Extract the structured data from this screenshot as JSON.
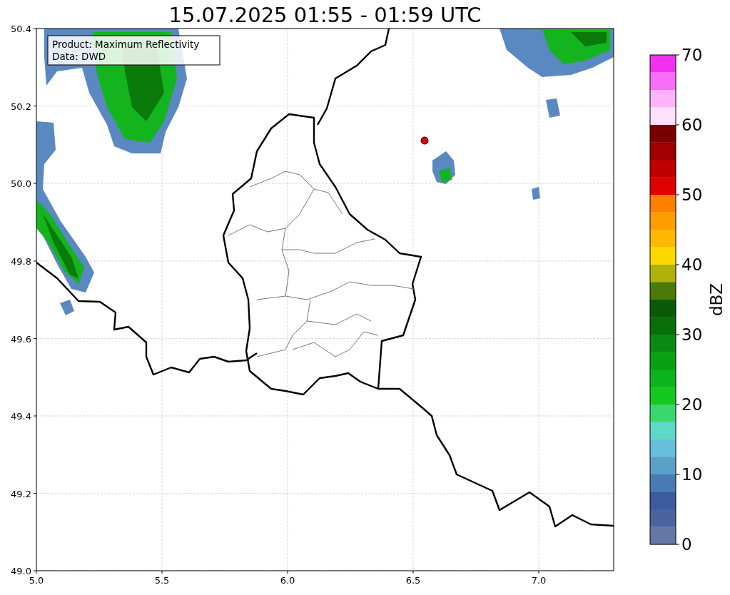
{
  "title": "15.07.2025 01:55 - 01:59 UTC",
  "info_box": {
    "lines": [
      "Product: Maximum Reflectivity",
      "Data: DWD"
    ]
  },
  "x_ticks": [
    "5.0",
    "5.5",
    "6.0",
    "6.5",
    "7.0"
  ],
  "y_ticks": [
    "50.4",
    "50.2",
    "50.0",
    "49.8",
    "49.6",
    "49.4",
    "49.2",
    "49.0"
  ],
  "colorbar": {
    "label": "dBZ",
    "ticks": [
      "70",
      "60",
      "50",
      "40",
      "30",
      "20",
      "10",
      "0"
    ],
    "segments": [
      {
        "color": "#f032f0"
      },
      {
        "color": "#f96ef8"
      },
      {
        "color": "#ffb3fb"
      },
      {
        "color": "#ffe0fd"
      },
      {
        "color": "#7a0000"
      },
      {
        "color": "#a00000"
      },
      {
        "color": "#c00000"
      },
      {
        "color": "#e00000"
      },
      {
        "color": "#ff7f00"
      },
      {
        "color": "#ff9e00"
      },
      {
        "color": "#ffb800"
      },
      {
        "color": "#ffd800"
      },
      {
        "color": "#aeb20a"
      },
      {
        "color": "#4a7a0a"
      },
      {
        "color": "#0a5a0a"
      },
      {
        "color": "#0a6e0a"
      },
      {
        "color": "#0a8a14"
      },
      {
        "color": "#0aa014"
      },
      {
        "color": "#0ab41e"
      },
      {
        "color": "#14c81e"
      },
      {
        "color": "#3cd66e"
      },
      {
        "color": "#5fd8c8"
      },
      {
        "color": "#64c0dc"
      },
      {
        "color": "#5aa0c8"
      },
      {
        "color": "#4a7ab4"
      },
      {
        "color": "#3c5aa0"
      },
      {
        "color": "#4a64a0"
      },
      {
        "color": "#6478a8"
      }
    ]
  }
}
